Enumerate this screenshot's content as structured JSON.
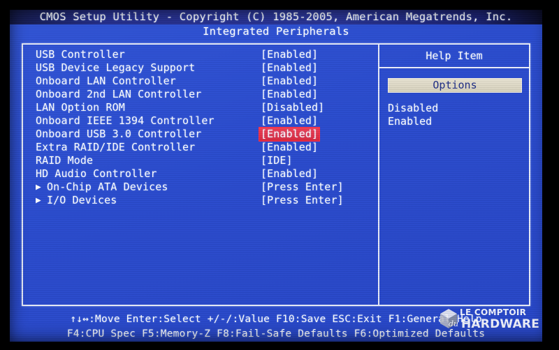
{
  "header": {
    "title": "CMOS Setup Utility - Copyright (C) 1985-2005, American Megatrends, Inc.",
    "subtitle": "Integrated Peripherals"
  },
  "settings": {
    "rows": [
      {
        "label": "USB Controller",
        "value": "[Enabled]",
        "submenu": false,
        "selected": false
      },
      {
        "label": "USB Device Legacy Support",
        "value": "[Enabled]",
        "submenu": false,
        "selected": false
      },
      {
        "label": "Onboard LAN Controller",
        "value": "[Enabled]",
        "submenu": false,
        "selected": false
      },
      {
        "label": "Onboard 2nd LAN Controller",
        "value": "[Enabled]",
        "submenu": false,
        "selected": false
      },
      {
        "label": "LAN Option ROM",
        "value": "[Disabled]",
        "submenu": false,
        "selected": false
      },
      {
        "label": "Onboard IEEE 1394 Controller",
        "value": "[Enabled]",
        "submenu": false,
        "selected": false
      },
      {
        "label": "Onboard USB 3.0 Controller",
        "value": "[Enabled]",
        "submenu": false,
        "selected": true
      },
      {
        "label": "Extra RAID/IDE Controller",
        "value": "[Enabled]",
        "submenu": false,
        "selected": false
      },
      {
        "label": "RAID Mode",
        "value": "[IDE]",
        "submenu": false,
        "selected": false
      },
      {
        "label": "HD Audio Controller",
        "value": "[Enabled]",
        "submenu": false,
        "selected": false
      },
      {
        "label": "On-Chip ATA Devices",
        "value": "[Press Enter]",
        "submenu": true,
        "selected": false
      },
      {
        "label": "I/O Devices",
        "value": "[Press Enter]",
        "submenu": true,
        "selected": false
      }
    ],
    "submenu_arrow_glyph": "▶"
  },
  "help": {
    "title": "Help Item",
    "options_header": "Options",
    "options": [
      "Disabled",
      "Enabled"
    ]
  },
  "footer": {
    "line1": "↑↓↔:Move   Enter:Select   +/-/:Value   F10:Save   ESC:Exit   F1:General Help",
    "line2": "F4:CPU Spec   F5:Memory-Z   F8:Fail-Safe Defaults      F6:Optimized Defaults"
  },
  "watermark": {
    "top_text": "LE COMPTOIR",
    "du_text": "du",
    "bottom_text": "HARDWARE"
  },
  "colors": {
    "screen_blue": "#2d4fd2",
    "frame_white": "#e8ecf8",
    "selection_red": "#e8344a",
    "options_bar_bg": "#ddd8c6",
    "options_bar_text": "#1f2e86",
    "header_strip": "#1a1f5e",
    "bezel_black": "#000000"
  }
}
